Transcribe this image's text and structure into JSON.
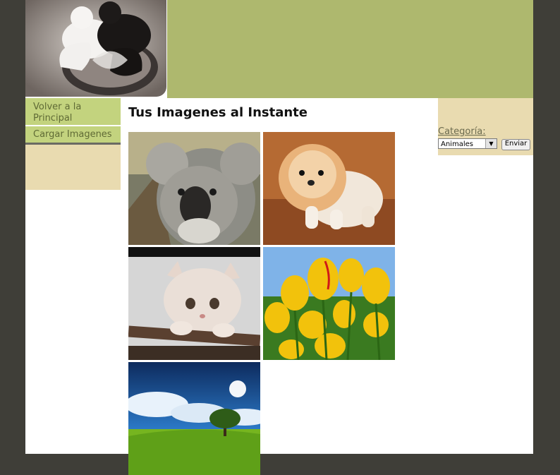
{
  "nav": {
    "items": [
      {
        "label": "Volver a la Principal"
      },
      {
        "label": "Cargar Imagenes"
      }
    ]
  },
  "main": {
    "title": "Tus Imagenes al Instante"
  },
  "gallery": {
    "images": [
      {
        "subject": "koala"
      },
      {
        "subject": "puppy"
      },
      {
        "subject": "kitten"
      },
      {
        "subject": "yellow tulips"
      },
      {
        "subject": "landscape with tree"
      }
    ]
  },
  "filter": {
    "label": "Categoría:",
    "selected": "Animales",
    "submit_label": "Enviar"
  },
  "colors": {
    "header": "#aeb86e",
    "nav": "#c3d37e",
    "sidebar": "#e9dbb0",
    "outer": "#3f3e38"
  }
}
